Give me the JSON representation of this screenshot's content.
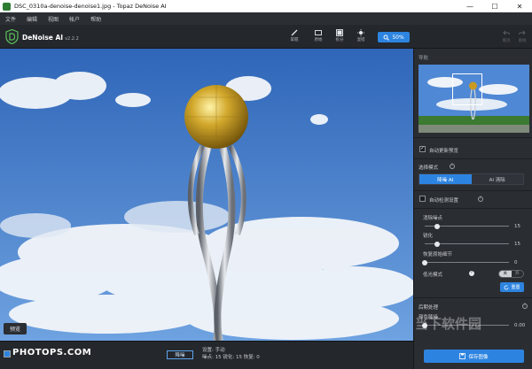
{
  "window": {
    "title": "DSC_0310a-denoise-denoise1.jpg - Topaz DeNoise AI",
    "minimize": "—",
    "maximize": "☐",
    "close": "✕"
  },
  "menu": {
    "items": [
      "文件",
      "编辑",
      "视图",
      "帐户",
      "帮助"
    ]
  },
  "toolbar": {
    "app_name": "DeNoise AI",
    "version": "v2.2.2",
    "tools": [
      {
        "label": "掌握",
        "icon": "brush-icon"
      },
      {
        "label": "原始",
        "icon": "original-image-icon"
      },
      {
        "label": "拆分",
        "icon": "split-view-icon"
      },
      {
        "label": "混搭",
        "icon": "blend-icon"
      }
    ],
    "zoom_label": "50%",
    "undo_label": "撤消",
    "redo_label": "重做"
  },
  "viewer": {
    "preview_label": "预览"
  },
  "bottom": {
    "brand": "PHOTOPS.COM",
    "mode_chip": "降噪",
    "settings_line1": "设置: 手动",
    "settings_line2": "噪点: 15  锐化: 15  恢复: 0"
  },
  "panel": {
    "navigator_title": "导航",
    "auto_update_label": "自动更新预览",
    "choose_mode_label": "选择模式",
    "modes": [
      "降噪 AI",
      "AI 清除"
    ],
    "auto_detect_label": "自动检测设置",
    "sliders": [
      {
        "label": "消除噪点",
        "value": "15",
        "fraction": 0.15
      },
      {
        "label": "锐化",
        "value": "15",
        "fraction": 0.15
      },
      {
        "label": "恢复原始细节",
        "value": "0",
        "fraction": 0
      }
    ],
    "lowlight_label": "低光模式",
    "toggle_on": "关",
    "toggle_off": "开",
    "reset_label": "重置",
    "post_title": "后期处理",
    "color_noise_label": "颜色降噪",
    "color_noise_value": "0.00",
    "save_label": "保存图像"
  },
  "colors": {
    "accent": "#2d84e0",
    "panel_bg": "#2a2d32",
    "sky": "#3d78c8"
  },
  "watermark": "当下软件园"
}
